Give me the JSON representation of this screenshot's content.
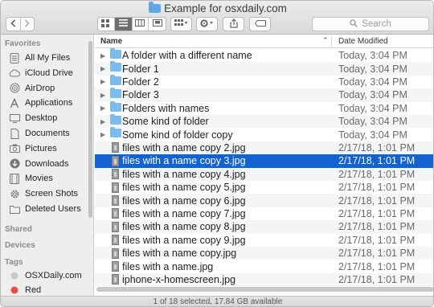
{
  "window": {
    "title": "Example for osxdaily.com"
  },
  "search": {
    "placeholder": "Search"
  },
  "sidebar": {
    "favorites_header": "Favorites",
    "favorites": [
      {
        "label": "All My Files",
        "icon": "all-files-icon"
      },
      {
        "label": "iCloud Drive",
        "icon": "cloud-icon"
      },
      {
        "label": "AirDrop",
        "icon": "airdrop-icon"
      },
      {
        "label": "Applications",
        "icon": "applications-icon"
      },
      {
        "label": "Desktop",
        "icon": "desktop-icon"
      },
      {
        "label": "Documents",
        "icon": "documents-icon"
      },
      {
        "label": "Pictures",
        "icon": "camera-icon"
      },
      {
        "label": "Downloads",
        "icon": "download-icon"
      },
      {
        "label": "Movies",
        "icon": "film-icon"
      },
      {
        "label": "Screen Shots",
        "icon": "gear-icon"
      },
      {
        "label": "Deleted Users",
        "icon": "folder-icon"
      }
    ],
    "shared_header": "Shared",
    "devices_header": "Devices",
    "tags_header": "Tags",
    "tags": [
      {
        "label": "OSXDaily.com",
        "color": "#c8c8c8"
      },
      {
        "label": "Red",
        "color": "#ee4b42"
      }
    ]
  },
  "list": {
    "col_name": "Name",
    "col_date": "Date Modified",
    "rows": [
      {
        "name": "A folder with a different name",
        "date": "Today, 3:04 PM",
        "kind": "folder"
      },
      {
        "name": "Folder 1",
        "date": "Today, 3:04 PM",
        "kind": "folder"
      },
      {
        "name": "Folder 2",
        "date": "Today, 3:04 PM",
        "kind": "folder"
      },
      {
        "name": "Folder 3",
        "date": "Today, 3:04 PM",
        "kind": "folder"
      },
      {
        "name": "Folders with names",
        "date": "Today, 3:04 PM",
        "kind": "folder"
      },
      {
        "name": "Some kind of folder",
        "date": "Today, 3:04 PM",
        "kind": "folder"
      },
      {
        "name": "Some kind of folder copy",
        "date": "Today, 3:04 PM",
        "kind": "folder"
      },
      {
        "name": "files with a name copy 2.jpg",
        "date": "2/17/18, 1:01 PM",
        "kind": "image"
      },
      {
        "name": "files with a name copy 3.jpg",
        "date": "2/17/18, 1:01 PM",
        "kind": "image",
        "selected": true
      },
      {
        "name": "files with a name copy 4.jpg",
        "date": "2/17/18, 1:01 PM",
        "kind": "image"
      },
      {
        "name": "files with a name copy 5.jpg",
        "date": "2/17/18, 1:01 PM",
        "kind": "image"
      },
      {
        "name": "files with a name copy 6.jpg",
        "date": "2/17/18, 1:01 PM",
        "kind": "image"
      },
      {
        "name": "files with a name copy 7.jpg",
        "date": "2/17/18, 1:01 PM",
        "kind": "image"
      },
      {
        "name": "files with a name copy 8.jpg",
        "date": "2/17/18, 1:01 PM",
        "kind": "image"
      },
      {
        "name": "files with a name copy 9.jpg",
        "date": "2/17/18, 1:01 PM",
        "kind": "image"
      },
      {
        "name": "files with a name copy.jpg",
        "date": "2/17/18, 1:01 PM",
        "kind": "image"
      },
      {
        "name": "files with a name.jpg",
        "date": "2/17/18, 1:01 PM",
        "kind": "image"
      },
      {
        "name": "iphone-x-homescreen.jpg",
        "date": "2/17/18, 1:01 PM",
        "kind": "image"
      }
    ]
  },
  "status": {
    "text": "1 of 18 selected, 17.84 GB available"
  },
  "colors": {
    "selection": "#1262d2",
    "folder": "#7bbcef",
    "window_chrome": "#e3e3e3"
  }
}
